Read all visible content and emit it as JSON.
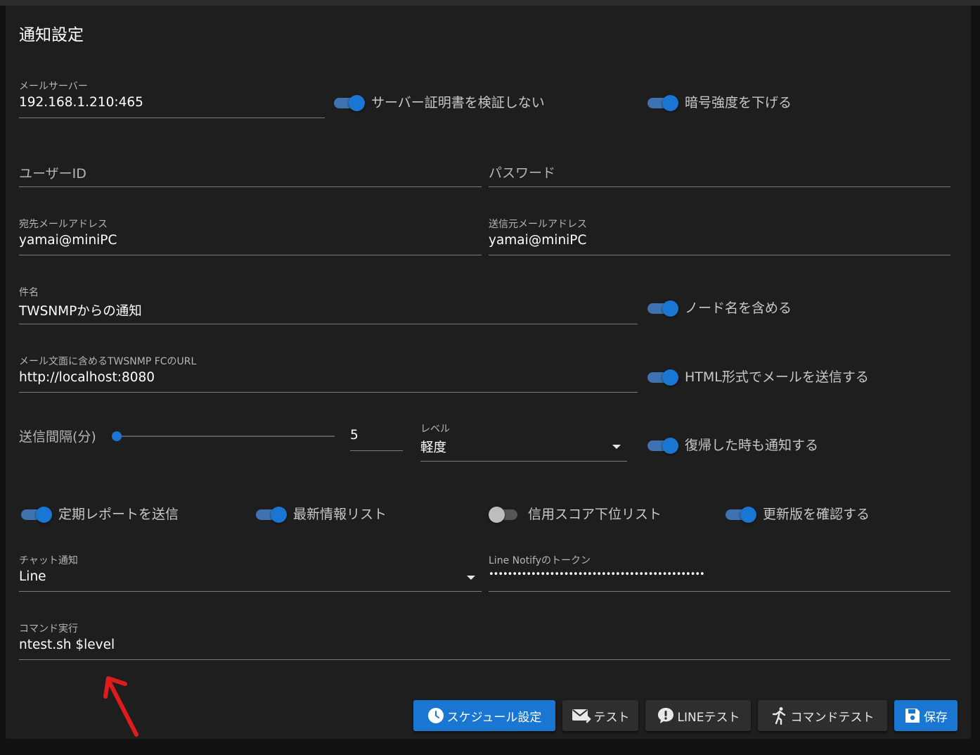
{
  "page_title": "通知設定",
  "mail_server": {
    "label": "メールサーバー",
    "value": "192.168.1.210:465"
  },
  "toggles_row1": [
    {
      "label": "サーバー証明書を検証しない",
      "on": true
    },
    {
      "label": "暗号強度を下げる",
      "on": true
    }
  ],
  "user_id": {
    "placeholder": "ユーザーID"
  },
  "password": {
    "placeholder": "パスワード"
  },
  "to_address": {
    "label": "宛先メールアドレス",
    "value": "yamai@miniPC"
  },
  "from_address": {
    "label": "送信元メールアドレス",
    "value": "yamai@miniPC"
  },
  "subject": {
    "label": "件名",
    "value": "TWSNMPからの通知"
  },
  "toggle_node_name": {
    "label": "ノード名を含める",
    "on": true
  },
  "url_field": {
    "label": "メール文面に含めるTWSNMP FCのURL",
    "value": "http://localhost:8080"
  },
  "toggle_html": {
    "label": "HTML形式でメールを送信する",
    "on": true
  },
  "interval": {
    "label": "送信間隔(分)",
    "value": "5",
    "slider_fraction": 0.0
  },
  "level": {
    "label": "レベル",
    "value": "軽度"
  },
  "toggle_recover": {
    "label": "復帰した時も通知する",
    "on": true
  },
  "toggles_row2": [
    {
      "label": "定期レポートを送信",
      "on": true
    },
    {
      "label": "最新情報リスト",
      "on": true
    },
    {
      "label": "信用スコア下位リスト",
      "on": false
    },
    {
      "label": "更新版を確認する",
      "on": true
    }
  ],
  "chat": {
    "label": "チャット通知",
    "value": "Line"
  },
  "line_token": {
    "label": "Line Notifyのトークン",
    "value": "••••••••••••••••••••••••••••••••••••••••••••••"
  },
  "command": {
    "label": "コマンド実行",
    "value": "ntest.sh $level"
  },
  "buttons": {
    "schedule": "スケジュール設定",
    "test": "テスト",
    "line_test": "LINEテスト",
    "command_test": "コマンドテスト",
    "save": "保存"
  },
  "colors": {
    "accent": "#1976d2",
    "annotation_arrow": "#e01b1b"
  }
}
